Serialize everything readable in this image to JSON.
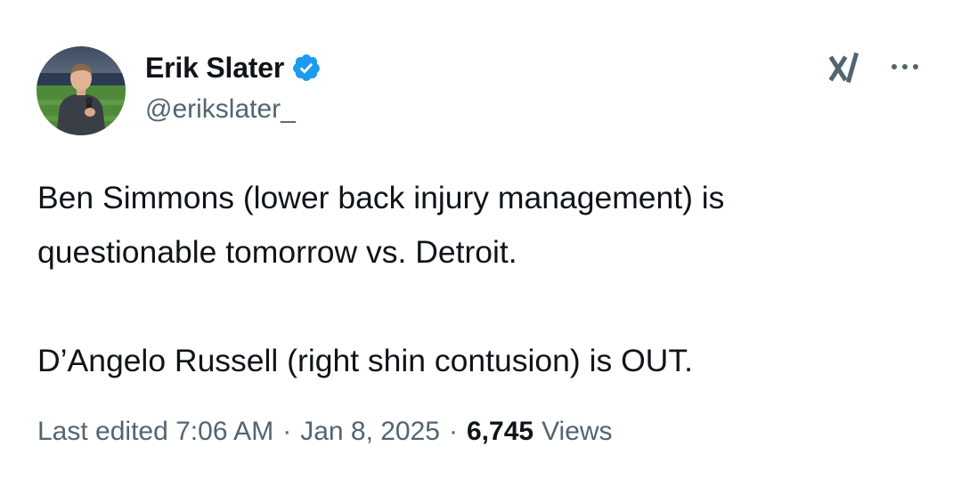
{
  "author": {
    "display_name": "Erik Slater",
    "handle": "@erikslater_",
    "verified": true,
    "verified_icon": "verified-badge-icon",
    "avatar_icon": "profile-photo"
  },
  "header_actions": {
    "grok_icon": "grok-icon",
    "more_icon": "more-options-icon"
  },
  "tweet": {
    "line1": "Ben Simmons (lower back injury management) is",
    "line2": "questionable tomorrow vs. Detroit.",
    "line3": "D’Angelo Russell (right shin contusion) is OUT."
  },
  "meta": {
    "edited_time": "Last edited 7:06 AM",
    "separator": "·",
    "date": "Jan 8, 2025",
    "views_count": "6,745",
    "views_label": "Views"
  },
  "colors": {
    "text_primary": "#0f1419",
    "text_secondary": "#536471",
    "verified_blue": "#1d9bf0"
  }
}
